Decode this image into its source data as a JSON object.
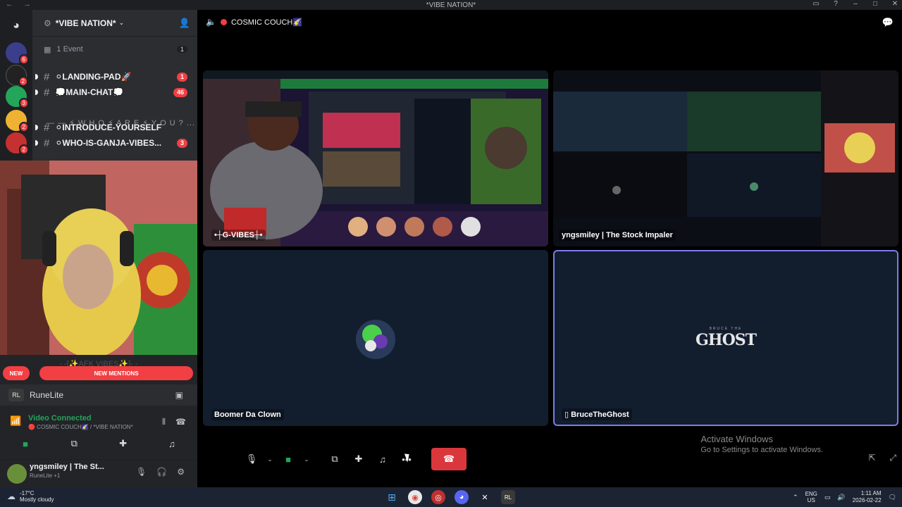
{
  "window": {
    "title": "*VIBE NATION*",
    "nav_back": "←",
    "nav_forward": "→"
  },
  "server": {
    "name": "*VIBE NATION*",
    "events_label": "1 Event",
    "events_count": "1"
  },
  "channels": [
    {
      "name": "⚪LANDING-PAD🚀",
      "badge": "1"
    },
    {
      "name": "💭MAIN-CHAT💭",
      "badge": "46"
    },
    {
      "name": "⚪INTRODUCE-YOURSELF",
      "badge": ""
    },
    {
      "name": "⚪WHO-IS-GANJA-VIBES...",
      "badge": "3"
    }
  ],
  "category": "— — ⚡ W H O ⚡ A R E ⚡ Y O U ? ...",
  "rail_badges": [
    "6",
    "2",
    "3",
    "2",
    "2"
  ],
  "lower": {
    "afk": "- -[✨AFK VIBES✨]- -",
    "new_label": "NEW",
    "mentions_label": "NEW MENTIONS",
    "activity": "RuneLite"
  },
  "voice": {
    "status": "Video Connected",
    "channel": "🔴 COSMIC COUCH🌠 / *VIBE NATION*",
    "buttons": [
      "video-icon",
      "screen-share-icon",
      "activities-icon",
      "soundboard-icon"
    ]
  },
  "user": {
    "name": "yngsmiley | The St...",
    "status": "RuneLite +1"
  },
  "stage": {
    "channel": "COSMIC COUCH🌠",
    "tiles": [
      {
        "name": "•┼G-VIBES┼•"
      },
      {
        "name": "yngsmiley | The Stock Impaler"
      },
      {
        "name": "Boomer Da Clown"
      },
      {
        "name": "BruceTheGhost"
      }
    ],
    "ghost_logo_top": "BRUCE THE",
    "ghost_logo": "GHOST"
  },
  "watermark": {
    "line1": "Activate Windows",
    "line2": "Go to Settings to activate Windows."
  },
  "taskbar": {
    "temp": "-17°C",
    "weather": "Mostly cloudy",
    "lang1": "ENG",
    "lang2": "US",
    "time": "1:11 AM",
    "date": "2026-02-22"
  }
}
